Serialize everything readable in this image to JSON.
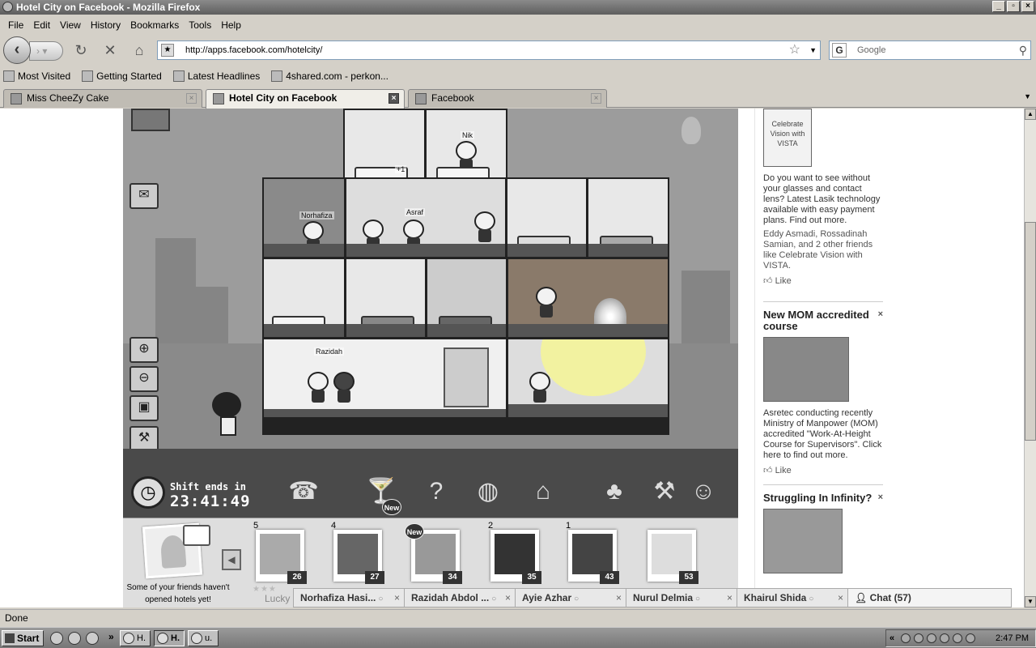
{
  "window": {
    "title": "Hotel City on Facebook - Mozilla Firefox"
  },
  "menu": [
    "File",
    "Edit",
    "View",
    "History",
    "Bookmarks",
    "Tools",
    "Help"
  ],
  "nav": {
    "url": "http://apps.facebook.com/hotelcity/",
    "search_placeholder": "Google"
  },
  "bookmarks": [
    "Most Visited",
    "Getting Started",
    "Latest Headlines",
    "4shared.com - perkon..."
  ],
  "tabs": [
    {
      "label": "Miss CheeZy Cake",
      "active": false
    },
    {
      "label": "Hotel City on Facebook",
      "active": true
    },
    {
      "label": "Facebook",
      "active": false
    }
  ],
  "game": {
    "guest_names": [
      "Nik",
      "Norhafiza",
      "Asraf",
      "Razidah"
    ],
    "room_counter": "+1",
    "shift_label": "Shift ends in",
    "shift_time": "23:41:49",
    "new_badge": "New"
  },
  "friends": {
    "promo_text": "Some of your friends haven't opened hotels yet!",
    "lucky": "Lucky",
    "list": [
      {
        "rank": "5",
        "level": "26"
      },
      {
        "rank": "4",
        "level": "27"
      },
      {
        "rank": "",
        "level": "34",
        "new": "New"
      },
      {
        "rank": "2",
        "level": "35"
      },
      {
        "rank": "1",
        "level": "43"
      },
      {
        "rank": "",
        "level": "53"
      }
    ]
  },
  "sidebar": {
    "ad1": {
      "logo_text": "Celebrate Vision with VISTA",
      "body": "Do you want to see without your glasses and contact lens? Latest Lasik technology available with easy payment plans. Find out more.",
      "likes": "Eddy Asmadi, Rossadinah Samian, and 2 other friends like Celebrate Vision with VISTA.",
      "like": "Like"
    },
    "ad2": {
      "title": "New MOM accredited course",
      "body": "Asretec conducting recently Ministry of Manpower (MOM) accredited \"Work-At-Height Course for Supervisors\". Click here to find out more.",
      "like": "Like"
    },
    "ad3": {
      "title": "Struggling In Infinity?"
    }
  },
  "chat": {
    "tabs": [
      "Norhafiza Hasi...",
      "Razidah Abdol ...",
      "Ayie Azhar",
      "Nurul Delmia",
      "Khairul Shida"
    ],
    "main": "Chat (57)"
  },
  "status": "Done",
  "taskbar": {
    "start": "Start",
    "tasks": [
      "H.",
      "H.",
      "u."
    ],
    "clock": "2:47 PM"
  },
  "colors": {
    "fire_glow": "#f2f2a0",
    "bg": "#9c9c9c"
  }
}
